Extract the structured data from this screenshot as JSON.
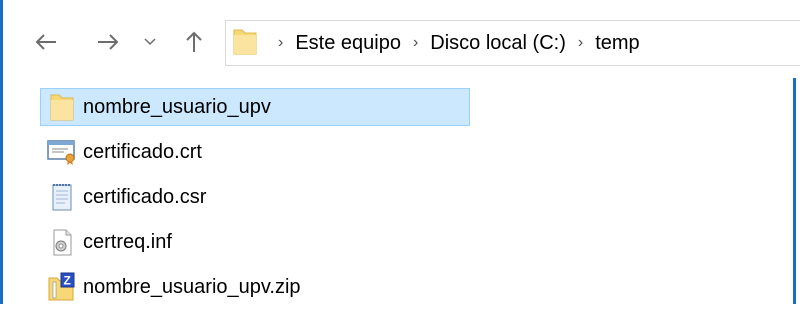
{
  "colors": {
    "accent_border": "#1a6fc4",
    "selection_bg": "#cce8ff",
    "selection_border": "#99d1ff",
    "folder_yellow": "#f8d775"
  },
  "navigation": {
    "back_icon": "arrow-left-icon",
    "forward_icon": "arrow-right-icon",
    "recent_icon": "chevron-down-icon",
    "up_icon": "arrow-up-icon"
  },
  "breadcrumb": {
    "folder_icon": "folder-icon",
    "items": [
      "Este equipo",
      "Disco local (C:)",
      "temp"
    ]
  },
  "files": [
    {
      "name": "nombre_usuario_upv",
      "icon": "folder-icon",
      "selected": true
    },
    {
      "name": "certificado.crt",
      "icon": "certificate-icon",
      "selected": false
    },
    {
      "name": "certificado.csr",
      "icon": "text-document-icon",
      "selected": false
    },
    {
      "name": "certreq.inf",
      "icon": "setup-info-icon",
      "selected": false
    },
    {
      "name": "nombre_usuario_upv.zip",
      "icon": "zip-archive-icon",
      "selected": false
    }
  ]
}
